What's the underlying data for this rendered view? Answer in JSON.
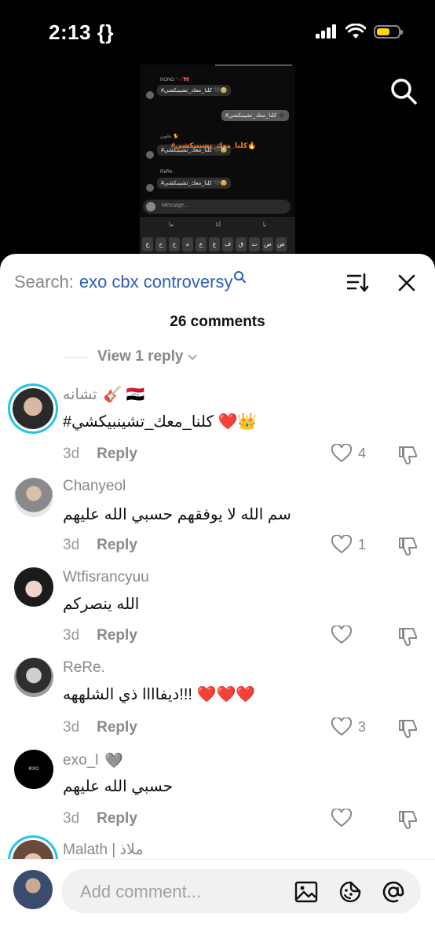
{
  "status_bar": {
    "time": "2:13 {}"
  },
  "preview": {
    "bubbles": [
      {
        "text": "#كلنا_معك_تشينبكشي 🖤🥹",
        "name": "NONO ⁺‧₊˚🎀"
      },
      {
        "text": "#كلنا_معك_تشينبكشي 🖤"
      },
      {
        "text": "#كلنا_معك_تشينبكشي 🖤🥹",
        "overlay": "#كلنا_معك_تشينبكشي🔥",
        "name": "بتاوين 🐈"
      },
      {
        "text": "#كلنا_معك_تشينبكشي 🖤🥹",
        "name": "ReRe."
      }
    ],
    "message_placeholder": "Message...",
    "suggestions": [
      "ما",
      "أنا",
      "يا"
    ],
    "keys": [
      "ج",
      "ح",
      "خ",
      "ه",
      "ع",
      "غ",
      "ف",
      "ق",
      "ث",
      "ص",
      "ض"
    ]
  },
  "sheet": {
    "search_label": "Search:",
    "search_query": "exo cbx controversy",
    "comment_count": "26 comments",
    "view_reply": "View 1 reply"
  },
  "comments": [
    {
      "name": "تشانه",
      "name_emoji": "🎸 🇮🇶",
      "text": "#كلنا_معك_تشينبيكشي ❤️👑",
      "time": "3d",
      "reply": "Reply",
      "likes": "4"
    },
    {
      "name": "Chanyeol",
      "text": "سم الله لا يوفقهم حسبي الله عليهم",
      "time": "3d",
      "reply": "Reply",
      "likes": "1"
    },
    {
      "name": "Wtfisrancyuu",
      "text": "الله ينصركم",
      "time": "3d",
      "reply": "Reply",
      "likes": ""
    },
    {
      "name": "ReRe.",
      "text": "ديفاااا ذي الشلههه!!! ❤️❤️❤️",
      "time": "3d",
      "reply": "Reply",
      "likes": "3"
    },
    {
      "name": "exo_l",
      "name_emoji": "🩶",
      "text": "حسبي الله عليهم",
      "time": "3d",
      "reply": "Reply",
      "likes": ""
    },
    {
      "name": "Malath | ملاذ"
    }
  ],
  "bottom": {
    "placeholder": "Add comment..."
  },
  "colors": {
    "accent_blue": "#2e5fb8",
    "ring": "#25c3e8",
    "battery": "#ffd60a"
  }
}
